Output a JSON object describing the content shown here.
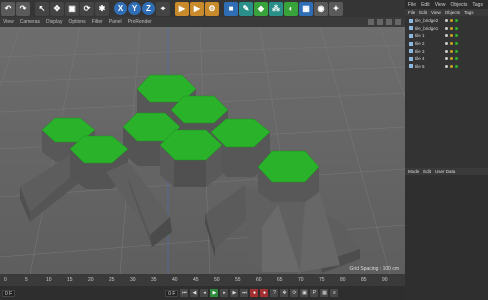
{
  "toolbar": {
    "axis_x": "X",
    "axis_y": "Y",
    "axis_z": "Z"
  },
  "viewport_menu": [
    "View",
    "Cameras",
    "Display",
    "Options",
    "Filter",
    "Panel",
    "ProRender"
  ],
  "viewport": {
    "grid_spacing": "Grid Spacing : 100 cm",
    "hex_top_color": "#29b22a",
    "hex_side_color": "#5f5f5f"
  },
  "object_tabs": [
    "File",
    "Edit",
    "View",
    "Objects",
    "Tags",
    "Bookmarks"
  ],
  "object_menu": [
    "File",
    "Edit",
    "View",
    "Objects",
    "Tags",
    "Book"
  ],
  "objects": [
    {
      "name": "tile_bridge2"
    },
    {
      "name": "tile_bridge1"
    },
    {
      "name": "tile 1"
    },
    {
      "name": "tile 2"
    },
    {
      "name": "tile 3"
    },
    {
      "name": "tile 4"
    },
    {
      "name": "tile 5"
    }
  ],
  "attributes_menu": [
    "Mode",
    "Edit",
    "User Data"
  ],
  "timeline": {
    "ticks": [
      "0",
      "5",
      "10",
      "15",
      "20",
      "25",
      "30",
      "35",
      "40",
      "45",
      "50",
      "55",
      "60",
      "65",
      "70",
      "75",
      "80",
      "85",
      "90"
    ],
    "current_frame": "0 F",
    "start_frame": "0 F",
    "end_frame": "90 F",
    "max_frame": "90 F"
  }
}
